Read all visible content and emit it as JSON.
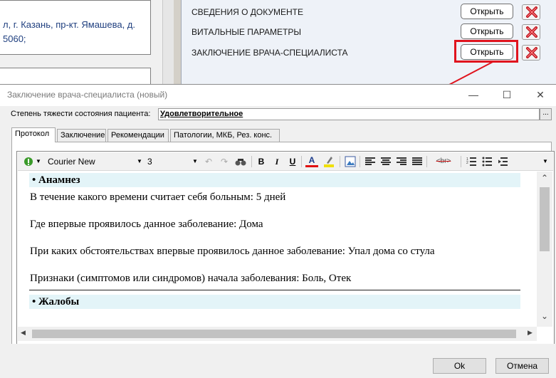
{
  "background": {
    "address_line1": "л, г. Казань, пр-кт. Ямашева, д.",
    "address_line2": "5060;",
    "documents": [
      {
        "label": "СВЕДЕНИЯ О ДОКУМЕНТЕ",
        "open_label": "Открыть"
      },
      {
        "label": "ВИТАЛЬНЫЕ ПАРАМЕТРЫ",
        "open_label": "Открыть"
      },
      {
        "label": "ЗАКЛЮЧЕНИЕ ВРАЧА-СПЕЦИАЛИСТА",
        "open_label": "Открыть"
      }
    ],
    "highlight_color": "#e0141e"
  },
  "dialog": {
    "title": "Заключение врача-специалиста (новый)",
    "controls": {
      "minimize": "—",
      "maximize": "☐",
      "close": "✕"
    },
    "severity_label": "Степень тяжести состояния пациента:",
    "severity_value": "Удовлетворительное",
    "severity_button": "...",
    "tabs": [
      {
        "label": "Протокол",
        "active": true
      },
      {
        "label": "Заключение",
        "active": false
      },
      {
        "label": "Рекомендации",
        "active": false
      },
      {
        "label": "Патологии, МКБ, Рез. конс.",
        "active": false
      }
    ],
    "toolbar": {
      "font": "Courier New",
      "size": "3",
      "bold": "B",
      "italic": "I",
      "underline": "U",
      "font_color": "A",
      "br_label": "<br>"
    },
    "content": {
      "section1_title": "Анамнез",
      "paragraphs": [
        "В течение какого времени считает себя больным: 5 дней",
        "Где впервые проявилось данное заболевание: Дома",
        "При каких обстоятельствах впервые проявилось данное заболевание: Упал дома со стула",
        "Признаки (симптомов или синдромов) начала заболевания: Боль, Отек"
      ],
      "section2_title": "Жалобы"
    },
    "ok_label": "Ok",
    "cancel_label": "Отмена"
  }
}
